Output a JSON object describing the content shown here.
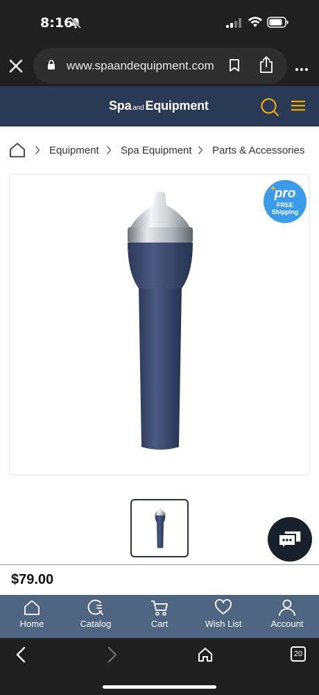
{
  "status_bar": {
    "time": "8:16",
    "icons": [
      "bell-slash-icon",
      "signal-icon",
      "wifi-icon",
      "battery-icon"
    ]
  },
  "browser": {
    "url": "www.spaandequipment.com",
    "tab_count": "20",
    "icons": [
      "close-icon",
      "lock-icon",
      "bookmark-icon",
      "share-icon",
      "more-icon",
      "back-icon",
      "forward-icon",
      "home-icon",
      "tabs-icon"
    ]
  },
  "header": {
    "logo_part1": "Spa",
    "logo_part2": "and",
    "logo_part3": "Equipment",
    "icons": [
      "search-icon",
      "menu-icon"
    ],
    "accent_color": "#f2a900",
    "bg_color": "#2a3a56"
  },
  "breadcrumb": {
    "items": [
      {
        "label": "Equipment"
      },
      {
        "label": "Spa Equipment"
      },
      {
        "label": "Parts & Accessories"
      }
    ]
  },
  "badge": {
    "plus": "+",
    "word": "pro",
    "line1": "FREE",
    "line2": "Shipping",
    "color": "#3b9be8"
  },
  "product": {
    "price": "$79.00"
  },
  "bottom_nav": {
    "items": [
      {
        "label": "Home",
        "icon": "home-icon"
      },
      {
        "label": "Catalog",
        "icon": "catalog-icon"
      },
      {
        "label": "Cart",
        "icon": "cart-icon"
      },
      {
        "label": "Wish List",
        "icon": "heart-icon"
      },
      {
        "label": "Account",
        "icon": "user-icon"
      }
    ],
    "bg_color": "#4f6582"
  }
}
